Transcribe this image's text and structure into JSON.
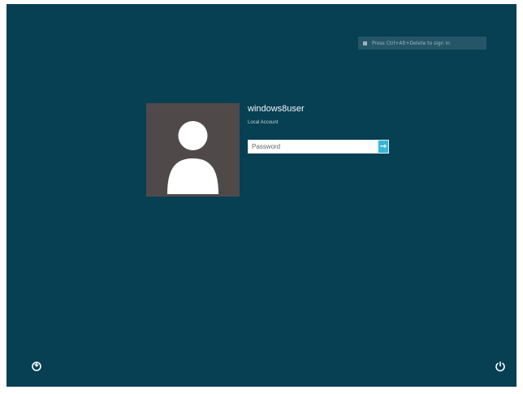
{
  "screen": {
    "background_color": "#073f53"
  },
  "notice": {
    "text": "Press Ctrl+Alt+Delete to sign in"
  },
  "user": {
    "name": "windows8user",
    "account_type": "Local Account"
  },
  "password": {
    "placeholder": "Password"
  },
  "icons": {
    "ease_of_access": "accessibility-icon",
    "power": "power-icon",
    "submit": "arrow-right-icon"
  }
}
